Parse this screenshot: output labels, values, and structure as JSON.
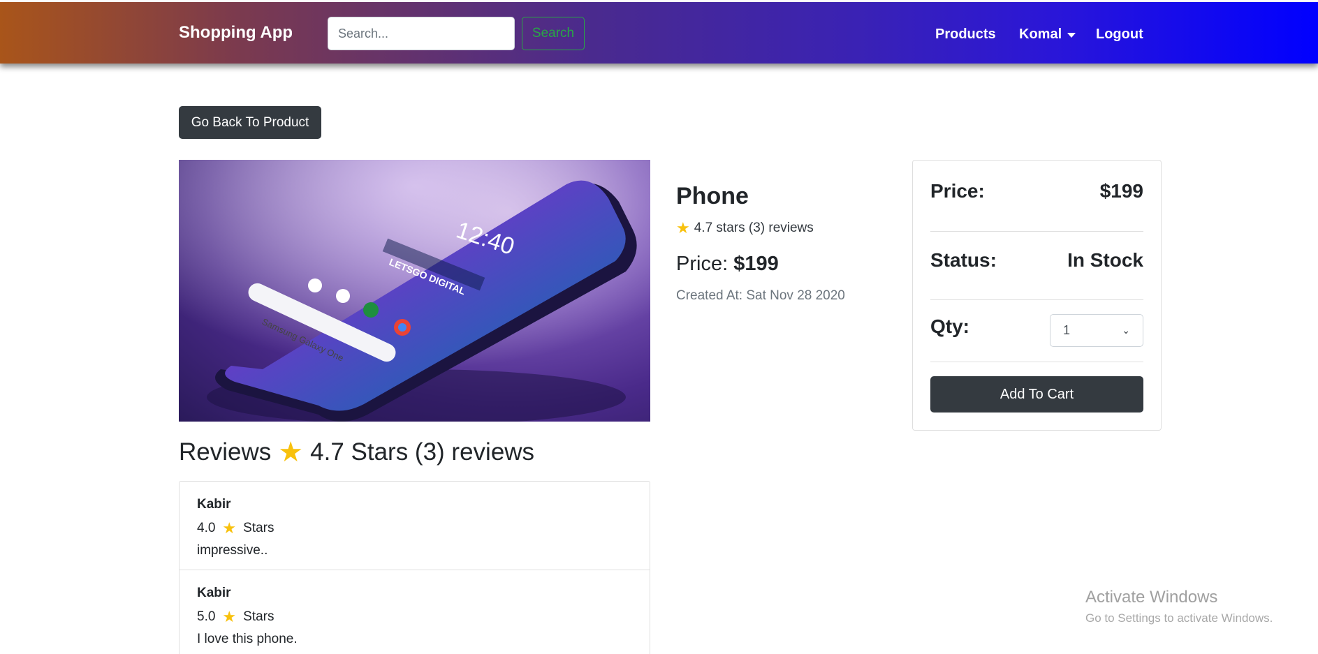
{
  "navbar": {
    "brand": "Shopping App",
    "search_placeholder": "Search...",
    "search_button": "Search",
    "links": {
      "products": "Products",
      "user": "Komal",
      "logout": "Logout"
    }
  },
  "back_button": "Go Back To Product",
  "product": {
    "name": "Phone",
    "rating_text": "4.7 stars (3) reviews",
    "rating": 4.7,
    "price_label": "Price:",
    "price_value": "$199",
    "created_at": "Created At: Sat Nov 28 2020"
  },
  "cart_card": {
    "price_label": "Price:",
    "price_value": "$199",
    "status_label": "Status:",
    "status_value": "In Stock",
    "qty_label": "Qty:",
    "qty_selected": "1",
    "add_button": "Add To Cart"
  },
  "reviews": {
    "heading_prefix": "Reviews",
    "heading_summary": "4.7 Stars (3) reviews",
    "items": [
      {
        "name": "Kabir",
        "rating": "4.0",
        "rating_suffix": "Stars",
        "comment": "impressive.."
      },
      {
        "name": "Kabir",
        "rating": "5.0",
        "rating_suffix": "Stars",
        "comment": "I love this phone."
      }
    ]
  },
  "watermark": {
    "title": "Activate Windows",
    "subtitle": "Go to Settings to activate Windows."
  },
  "colors": {
    "dark_button": "#343a40",
    "search_green": "#28a745",
    "star": "#f8c10d"
  }
}
